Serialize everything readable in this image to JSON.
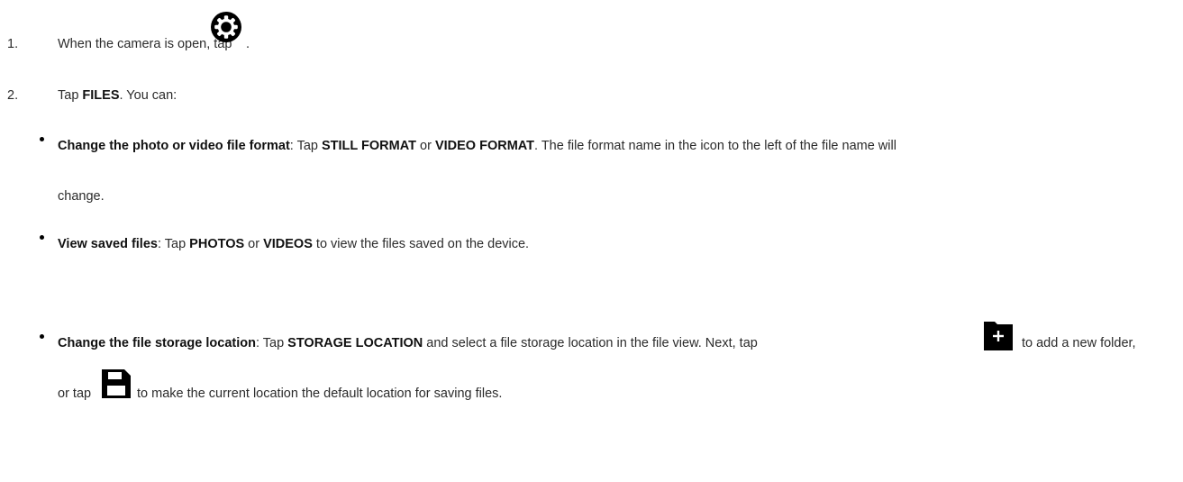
{
  "steps": [
    {
      "number": "1.",
      "text_before": "When the camera is open, tap",
      "icon": "gear-icon",
      "text_after": "."
    },
    {
      "number": "2.",
      "text_before": "Tap ",
      "bold": "FILES",
      "text_after": ". You can:"
    }
  ],
  "bullets": [
    {
      "title": "Change the photo or video file format",
      "text1": ": Tap ",
      "opt1": "STILL FORMAT",
      "text2": " or ",
      "opt2": "VIDEO FORMAT",
      "text3": ". The file format name in the icon to the left of the file name will",
      "continuation": "change."
    },
    {
      "title": "View saved files",
      "text1": ": Tap ",
      "opt1": "PHOTOS",
      "text2": " or ",
      "opt2": "VIDEOS",
      "text3": " to view the files saved on the device."
    },
    {
      "title": "Change the file storage location",
      "text1": ": Tap ",
      "opt1": "STORAGE LOCATION",
      "text2": " and select a file storage location in the file view. Next, tap",
      "icon1": "new-folder-icon",
      "text3": "to add a new folder,",
      "line2_before": "or tap",
      "icon2": "save-icon",
      "line2_after": "to make the current location the default location for saving files."
    }
  ]
}
